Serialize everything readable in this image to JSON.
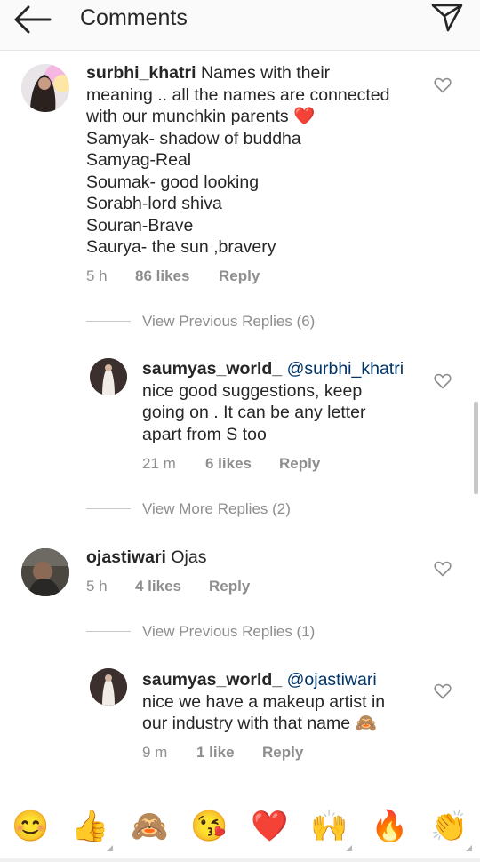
{
  "header": {
    "title": "Comments",
    "back_icon": "arrow-left-icon",
    "send_icon": "direct-send-icon"
  },
  "comments": [
    {
      "username": "surbhi_khatri",
      "text_lines": [
        " Names with their",
        "meaning .. all the names are connected",
        "with our munchkin parents ❤️",
        "Samyak- shadow of buddha",
        "Samyag-Real",
        "Soumak- good looking",
        "Sorabh-lord shiva",
        "Souran-Brave",
        "Saurya- the sun ,bravery"
      ],
      "time": "5 h",
      "likes": "86 likes",
      "reply": "Reply"
    },
    {
      "username": "saumyas_world_",
      "mention": "@surbhi_khatri",
      "text_lines": [
        "nice good suggestions, keep",
        "going on . It can be any letter",
        "apart from S too"
      ],
      "time": "21 m",
      "likes": "6 likes",
      "reply": "Reply"
    },
    {
      "username": "ojastiwari",
      "text": " Ojas",
      "time": "5 h",
      "likes": "4 likes",
      "reply": "Reply"
    },
    {
      "username": "saumyas_world_",
      "mention": "@ojastiwari",
      "text_lines": [
        "nice we have a makeup artist in",
        "our industry with that name 🙈"
      ],
      "time": "9 m",
      "likes": "1 like",
      "reply": "Reply"
    }
  ],
  "view_replies": [
    "View Previous Replies (6)",
    "View More Replies (2)",
    "View Previous Replies (1)"
  ],
  "emoji_bar": [
    "😊",
    "👍",
    "🙈",
    "😘",
    "❤️",
    "🙌",
    "🔥",
    "👏"
  ],
  "colors": {
    "mention": "#003569",
    "secondary_text": "#8e8e8e",
    "heart_outline": "#8e8e8e"
  }
}
